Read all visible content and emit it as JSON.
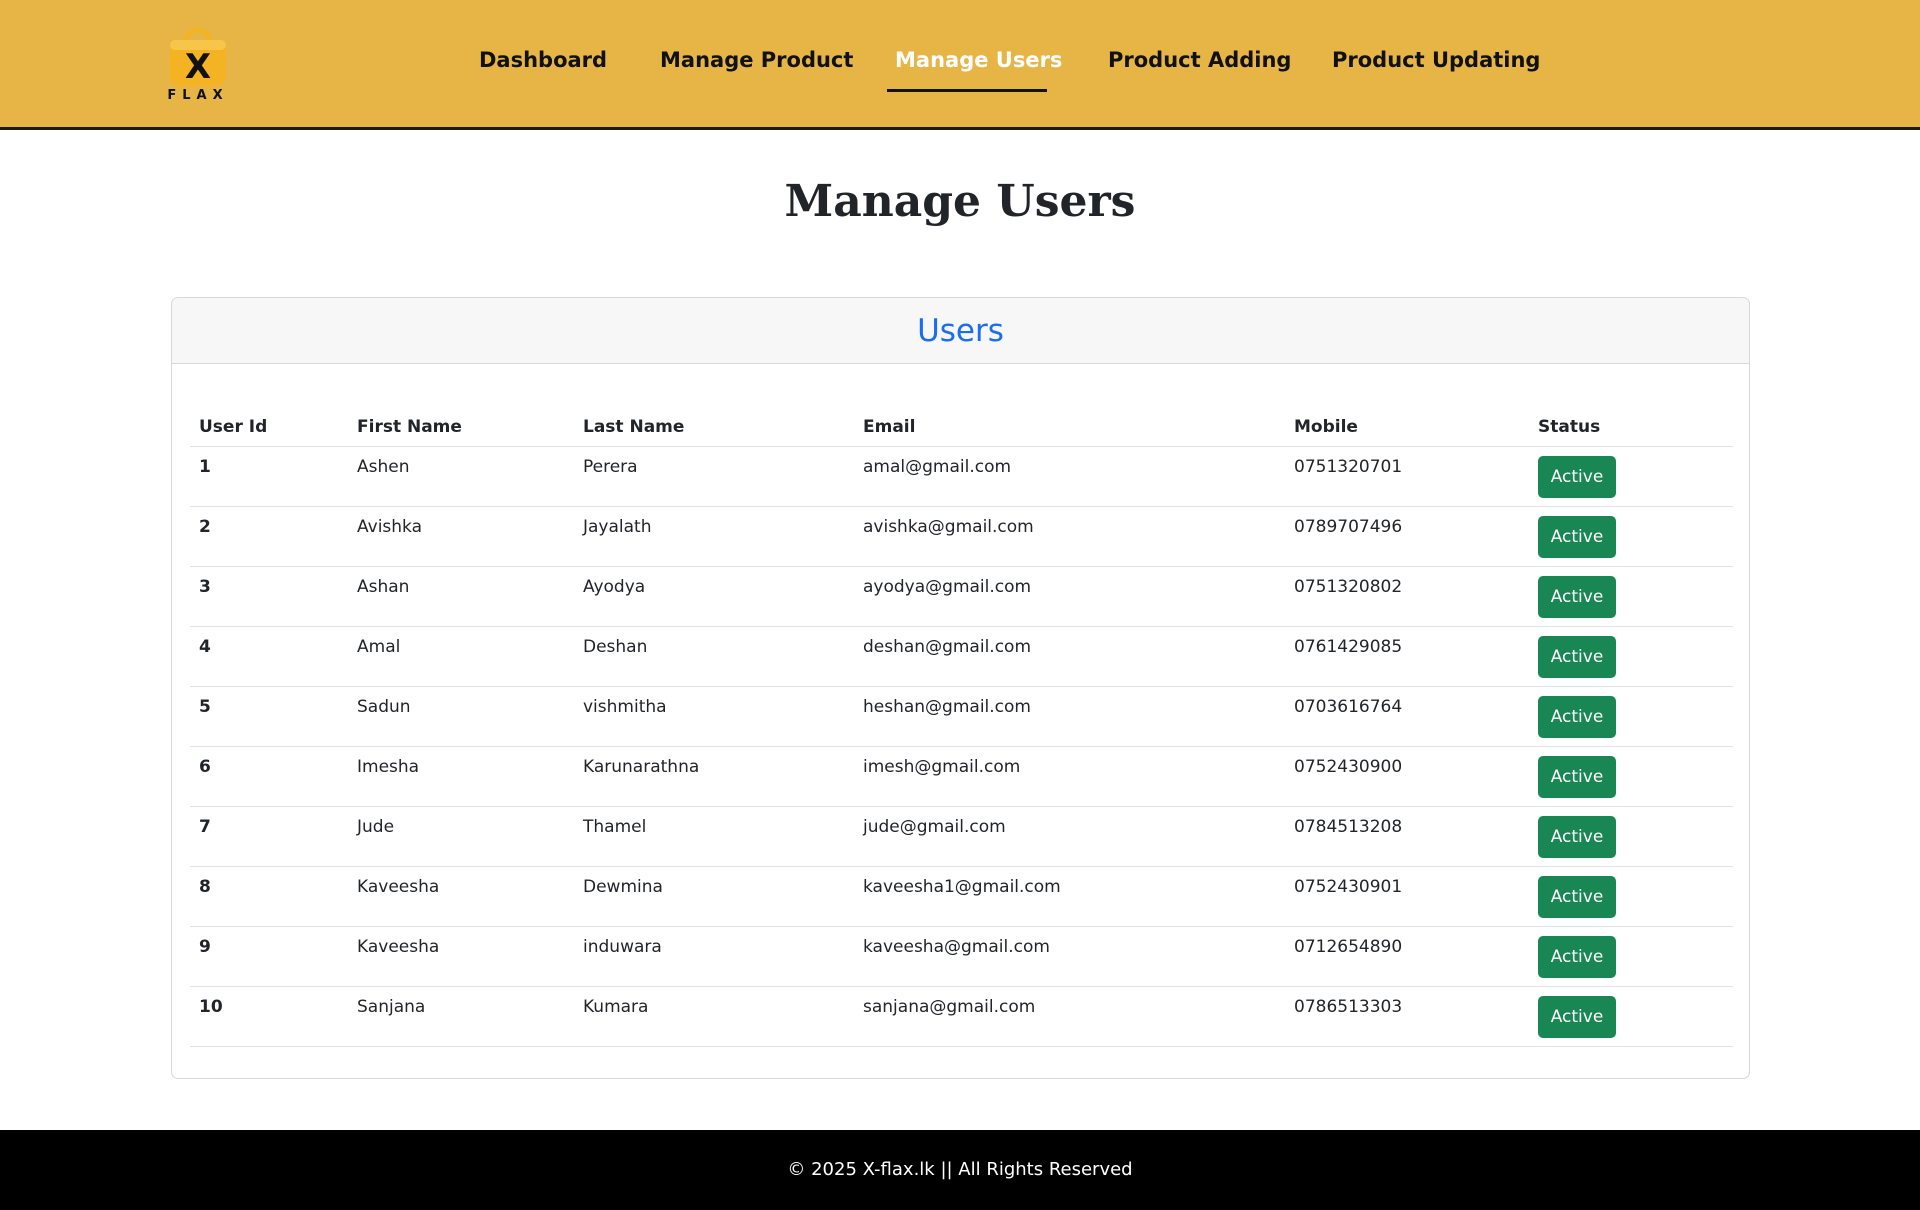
{
  "brand": {
    "logo_text": "FLAX",
    "logo_mark": "X",
    "colors": {
      "header_bg": "#e6b545",
      "bag": "#f3b323"
    }
  },
  "nav": {
    "items": [
      {
        "label": "Dashboard",
        "active": false
      },
      {
        "label": "Manage Product",
        "active": false
      },
      {
        "label": "Manage Users",
        "active": true
      },
      {
        "label": "Product Adding",
        "active": false
      },
      {
        "label": "Product Updating",
        "active": false
      }
    ]
  },
  "page": {
    "title": "Manage Users"
  },
  "users_card": {
    "header": "Users",
    "columns": [
      "User Id",
      "First Name",
      "Last Name",
      "Email",
      "Mobile",
      "Status"
    ],
    "rows": [
      {
        "id": "1",
        "first": "Ashen",
        "last": "Perera",
        "email": "amal@gmail.com",
        "mobile": "0751320701",
        "status": "Active"
      },
      {
        "id": "2",
        "first": "Avishka",
        "last": "Jayalath",
        "email": "avishka@gmail.com",
        "mobile": "0789707496",
        "status": "Active"
      },
      {
        "id": "3",
        "first": "Ashan",
        "last": "Ayodya",
        "email": "ayodya@gmail.com",
        "mobile": "0751320802",
        "status": "Active"
      },
      {
        "id": "4",
        "first": "Amal",
        "last": "Deshan",
        "email": "deshan@gmail.com",
        "mobile": "0761429085",
        "status": "Active"
      },
      {
        "id": "5",
        "first": "Sadun",
        "last": "vishmitha",
        "email": "heshan@gmail.com",
        "mobile": "0703616764",
        "status": "Active"
      },
      {
        "id": "6",
        "first": "Imesha",
        "last": "Karunarathna",
        "email": "imesh@gmail.com",
        "mobile": "0752430900",
        "status": "Active"
      },
      {
        "id": "7",
        "first": "Jude",
        "last": "Thamel",
        "email": "jude@gmail.com",
        "mobile": "0784513208",
        "status": "Active"
      },
      {
        "id": "8",
        "first": "Kaveesha",
        "last": "Dewmina",
        "email": "kaveesha1@gmail.com",
        "mobile": "0752430901",
        "status": "Active"
      },
      {
        "id": "9",
        "first": "Kaveesha",
        "last": "induwara",
        "email": "kaveesha@gmail.com",
        "mobile": "0712654890",
        "status": "Active"
      },
      {
        "id": "10",
        "first": "Sanjana",
        "last": "Kumara",
        "email": "sanjana@gmail.com",
        "mobile": "0786513303",
        "status": "Active"
      }
    ]
  },
  "footer": {
    "text": "© 2025 X-flax.lk || All Rights Reserved"
  }
}
